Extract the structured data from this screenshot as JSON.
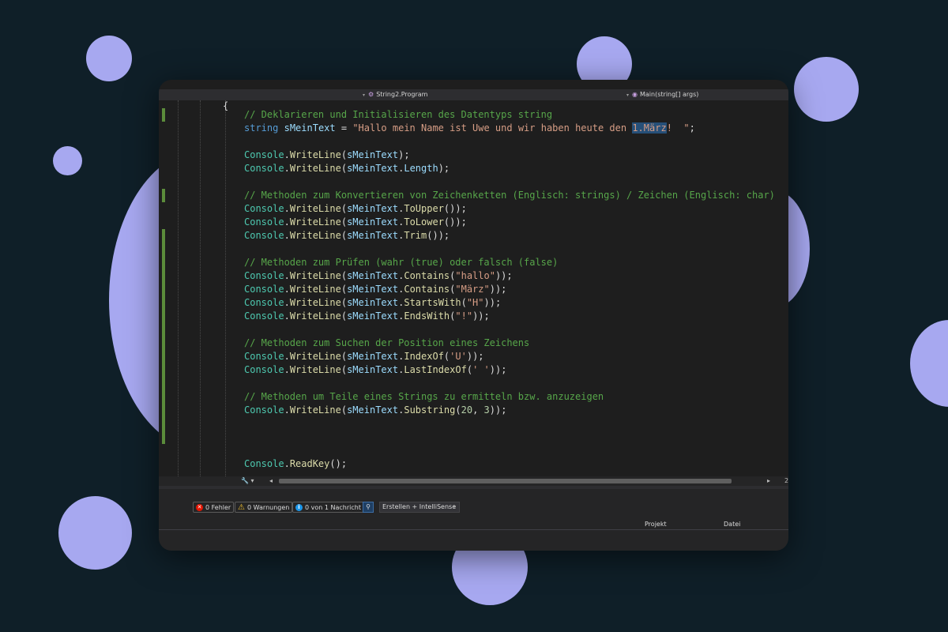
{
  "navbar": {
    "class_path": "String2.Program",
    "method": "Main(string[] args)"
  },
  "editor": {
    "open_brace": "{",
    "close_brace": "}",
    "lines": [
      [
        {
          "t": "// Deklarieren und Initialisieren des Datentyps string",
          "c": "com"
        }
      ],
      [
        {
          "t": "string",
          "c": "kw"
        },
        {
          "t": " "
        },
        {
          "t": "sMeinText",
          "c": "id"
        },
        {
          "t": " = "
        },
        {
          "t": "\"Hallo mein Name ist Uwe und wir haben heute den ",
          "c": "str"
        },
        {
          "t": "1.März",
          "c": "str sel"
        },
        {
          "t": "!  \"",
          "c": "str"
        },
        {
          "t": ";"
        }
      ],
      [],
      [
        {
          "t": "Console",
          "c": "typ"
        },
        {
          "t": "."
        },
        {
          "t": "WriteLine",
          "c": "mth"
        },
        {
          "t": "("
        },
        {
          "t": "sMeinText",
          "c": "id"
        },
        {
          "t": ");"
        }
      ],
      [
        {
          "t": "Console",
          "c": "typ"
        },
        {
          "t": "."
        },
        {
          "t": "WriteLine",
          "c": "mth"
        },
        {
          "t": "("
        },
        {
          "t": "sMeinText",
          "c": "id"
        },
        {
          "t": "."
        },
        {
          "t": "Length",
          "c": "id"
        },
        {
          "t": ");"
        }
      ],
      [],
      [
        {
          "t": "// Methoden zum Konvertieren von Zeichenketten (Englisch: strings) / Zeichen (Englisch: char)",
          "c": "com"
        }
      ],
      [
        {
          "t": "Console",
          "c": "typ"
        },
        {
          "t": "."
        },
        {
          "t": "WriteLine",
          "c": "mth"
        },
        {
          "t": "("
        },
        {
          "t": "sMeinText",
          "c": "id"
        },
        {
          "t": "."
        },
        {
          "t": "ToUpper",
          "c": "mth"
        },
        {
          "t": "());"
        }
      ],
      [
        {
          "t": "Console",
          "c": "typ"
        },
        {
          "t": "."
        },
        {
          "t": "WriteLine",
          "c": "mth"
        },
        {
          "t": "("
        },
        {
          "t": "sMeinText",
          "c": "id"
        },
        {
          "t": "."
        },
        {
          "t": "ToLower",
          "c": "mth"
        },
        {
          "t": "());"
        }
      ],
      [
        {
          "t": "Console",
          "c": "typ"
        },
        {
          "t": "."
        },
        {
          "t": "WriteLine",
          "c": "mth"
        },
        {
          "t": "("
        },
        {
          "t": "sMeinText",
          "c": "id"
        },
        {
          "t": "."
        },
        {
          "t": "Trim",
          "c": "mth"
        },
        {
          "t": "());"
        }
      ],
      [],
      [
        {
          "t": "// Methoden zum Prüfen (wahr (true) oder falsch (false)",
          "c": "com"
        }
      ],
      [
        {
          "t": "Console",
          "c": "typ"
        },
        {
          "t": "."
        },
        {
          "t": "WriteLine",
          "c": "mth"
        },
        {
          "t": "("
        },
        {
          "t": "sMeinText",
          "c": "id"
        },
        {
          "t": "."
        },
        {
          "t": "Contains",
          "c": "mth"
        },
        {
          "t": "("
        },
        {
          "t": "\"hallo\"",
          "c": "str"
        },
        {
          "t": "));"
        }
      ],
      [
        {
          "t": "Console",
          "c": "typ"
        },
        {
          "t": "."
        },
        {
          "t": "WriteLine",
          "c": "mth"
        },
        {
          "t": "("
        },
        {
          "t": "sMeinText",
          "c": "id"
        },
        {
          "t": "."
        },
        {
          "t": "Contains",
          "c": "mth"
        },
        {
          "t": "("
        },
        {
          "t": "\"März\"",
          "c": "str"
        },
        {
          "t": "));"
        }
      ],
      [
        {
          "t": "Console",
          "c": "typ"
        },
        {
          "t": "."
        },
        {
          "t": "WriteLine",
          "c": "mth"
        },
        {
          "t": "("
        },
        {
          "t": "sMeinText",
          "c": "id"
        },
        {
          "t": "."
        },
        {
          "t": "StartsWith",
          "c": "mth"
        },
        {
          "t": "("
        },
        {
          "t": "\"H\"",
          "c": "str"
        },
        {
          "t": "));"
        }
      ],
      [
        {
          "t": "Console",
          "c": "typ"
        },
        {
          "t": "."
        },
        {
          "t": "WriteLine",
          "c": "mth"
        },
        {
          "t": "("
        },
        {
          "t": "sMeinText",
          "c": "id"
        },
        {
          "t": "."
        },
        {
          "t": "EndsWith",
          "c": "mth"
        },
        {
          "t": "("
        },
        {
          "t": "\"!\"",
          "c": "str"
        },
        {
          "t": "));"
        }
      ],
      [],
      [
        {
          "t": "// Methoden zum Suchen der Position eines Zeichens",
          "c": "com"
        }
      ],
      [
        {
          "t": "Console",
          "c": "typ"
        },
        {
          "t": "."
        },
        {
          "t": "WriteLine",
          "c": "mth"
        },
        {
          "t": "("
        },
        {
          "t": "sMeinText",
          "c": "id"
        },
        {
          "t": "."
        },
        {
          "t": "IndexOf",
          "c": "mth"
        },
        {
          "t": "("
        },
        {
          "t": "'U'",
          "c": "str"
        },
        {
          "t": "));"
        }
      ],
      [
        {
          "t": "Console",
          "c": "typ"
        },
        {
          "t": "."
        },
        {
          "t": "WriteLine",
          "c": "mth"
        },
        {
          "t": "("
        },
        {
          "t": "sMeinText",
          "c": "id"
        },
        {
          "t": "."
        },
        {
          "t": "LastIndexOf",
          "c": "mth"
        },
        {
          "t": "("
        },
        {
          "t": "' '",
          "c": "str"
        },
        {
          "t": "));"
        }
      ],
      [],
      [
        {
          "t": "// Methoden um Teile eines Strings zu ermitteln bzw. anzuzeigen",
          "c": "com"
        }
      ],
      [
        {
          "t": "Console",
          "c": "typ"
        },
        {
          "t": "."
        },
        {
          "t": "WriteLine",
          "c": "mth"
        },
        {
          "t": "("
        },
        {
          "t": "sMeinText",
          "c": "id"
        },
        {
          "t": "."
        },
        {
          "t": "Substring",
          "c": "mth"
        },
        {
          "t": "("
        },
        {
          "t": "20",
          "c": "num"
        },
        {
          "t": ", "
        },
        {
          "t": "3",
          "c": "num"
        },
        {
          "t": "));"
        }
      ],
      [],
      [],
      [],
      [
        {
          "t": "Console",
          "c": "typ"
        },
        {
          "t": "."
        },
        {
          "t": "ReadKey",
          "c": "mth"
        },
        {
          "t": "();"
        }
      ]
    ]
  },
  "scrollbar": {
    "left_arrow": "◂",
    "right_arrow": "▸",
    "position_hint": "2"
  },
  "error_list": {
    "errors_label": "0 Fehler",
    "warnings_label": "0 Warnungen",
    "messages_label": "0 von 1 Nachricht",
    "scope_value": "Erstellen + IntelliSense",
    "col_project": "Projekt",
    "col_file": "Datei"
  },
  "colors": {
    "background": "#0f1f28",
    "bubble": "#a7a8f0",
    "comment": "#57a64a",
    "keyword": "#569cd6",
    "type": "#4ec9b0",
    "identifier": "#9cdcfe",
    "method": "#dcdcaa",
    "string": "#d69d85",
    "selection": "#264f78"
  }
}
